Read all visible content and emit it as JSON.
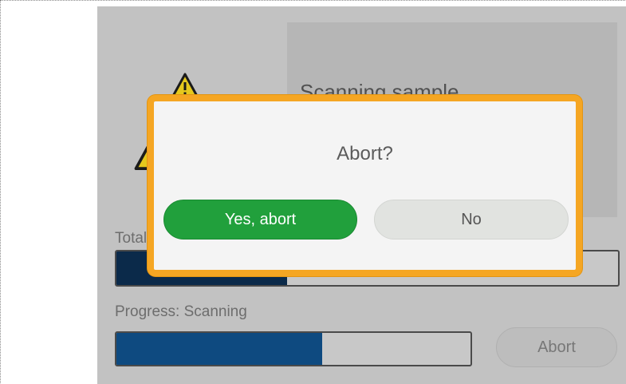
{
  "screen": {
    "info_panel_title": "Scanning sample",
    "total_label": "Total",
    "total_progress": 0.34,
    "progress_label": "Progress: Scanning",
    "scan_progress": 0.58,
    "abort_button_label": "Abort",
    "colors": {
      "total_fill": "#0b2a4a",
      "scan_fill": "#0e4a80",
      "warning_yellow": "#e5c81d"
    }
  },
  "dialog": {
    "title": "Abort?",
    "yes_label": "Yes, abort",
    "no_label": "No",
    "colors": {
      "border": "#f5a623",
      "yes": "#21a03c",
      "no": "#e1e3e0"
    }
  }
}
